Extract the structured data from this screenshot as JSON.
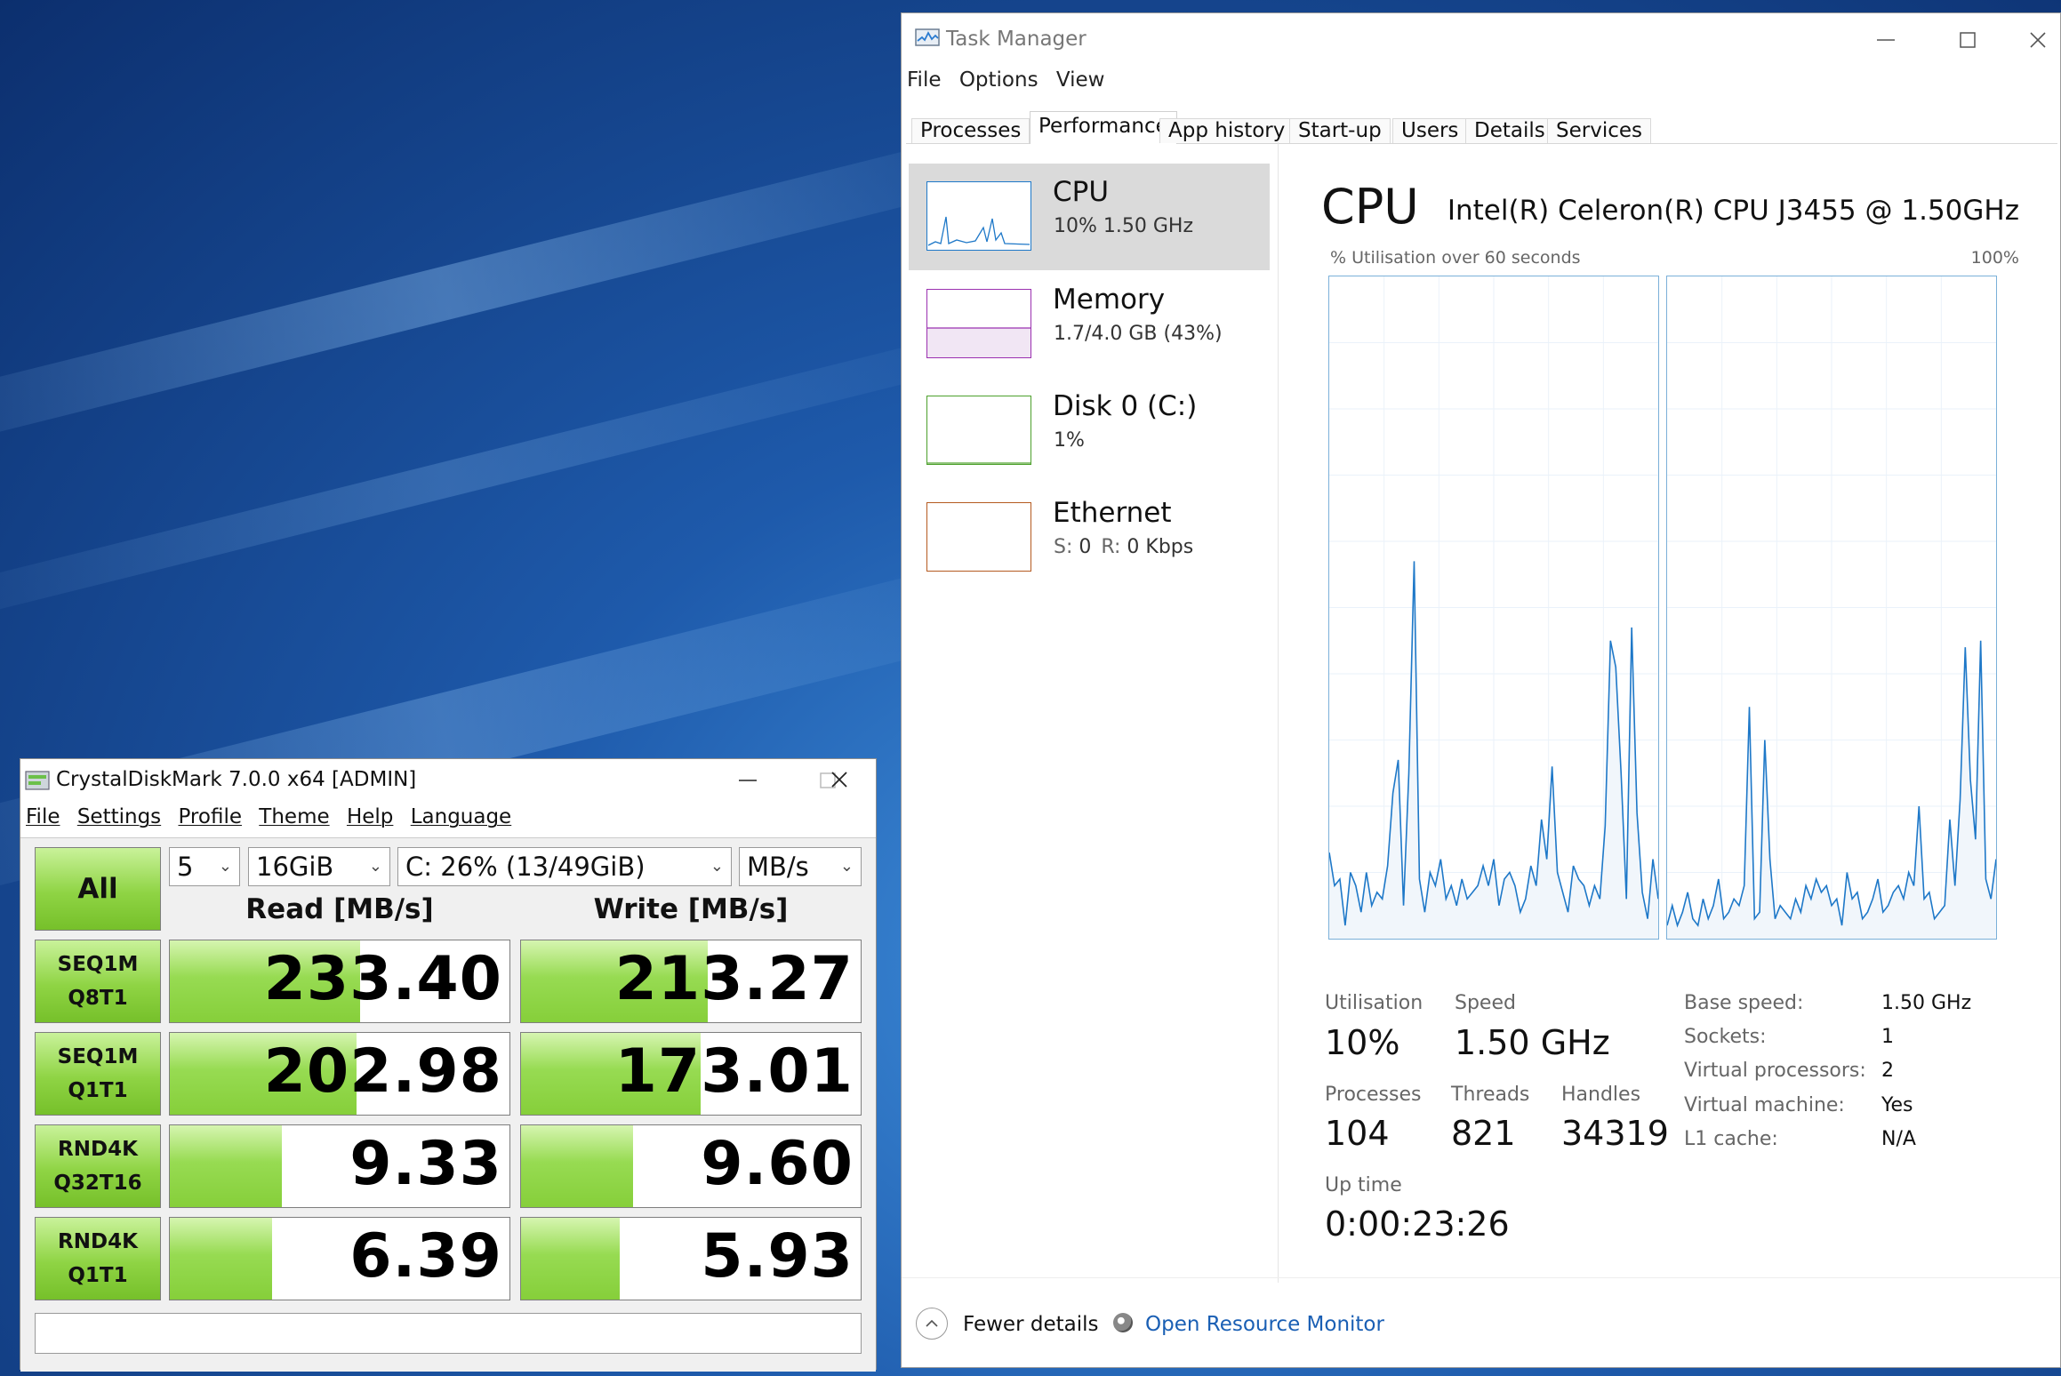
{
  "task_manager": {
    "title": "Task Manager",
    "menu": [
      "File",
      "Options",
      "View"
    ],
    "tabs": [
      "Processes",
      "Performance",
      "App history",
      "Start-up",
      "Users",
      "Details",
      "Services"
    ],
    "active_tab": "Performance",
    "resources": [
      {
        "name": "CPU",
        "value": "10%  1.50 GHz",
        "color": "#1e78c8"
      },
      {
        "name": "Memory",
        "value": "1.7/4.0 GB (43%)",
        "color": "#9b30b0"
      },
      {
        "name": "Disk 0 (C:)",
        "value": "1%",
        "color": "#4da02c"
      },
      {
        "name": "Ethernet",
        "value_s_label": "S:",
        "value_s": "0",
        "value_r_label": "R:",
        "value_r": "0 Kbps",
        "color": "#b55a20"
      }
    ],
    "cpu": {
      "heading": "CPU",
      "model": "Intel(R) Celeron(R) CPU J3455 @ 1.50GHz",
      "util_label": "% Utilisation over 60 seconds",
      "util_max": "100%",
      "stats": {
        "utilisation_label": "Utilisation",
        "utilisation": "10%",
        "speed_label": "Speed",
        "speed": "1.50 GHz",
        "processes_label": "Processes",
        "processes": "104",
        "threads_label": "Threads",
        "threads": "821",
        "handles_label": "Handles",
        "handles": "34319",
        "uptime_label": "Up time",
        "uptime": "0:00:23:26"
      },
      "specs": [
        {
          "label": "Base speed:",
          "value": "1.50 GHz"
        },
        {
          "label": "Sockets:",
          "value": "1"
        },
        {
          "label": "Virtual processors:",
          "value": "2"
        },
        {
          "label": "Virtual machine:",
          "value": "Yes"
        },
        {
          "label": "L1 cache:",
          "value": "N/A"
        }
      ],
      "core_graphs": [
        [
          13,
          8,
          9,
          2,
          10,
          8,
          4,
          10,
          5,
          7,
          6,
          11,
          22,
          27,
          5,
          25,
          57,
          9,
          4,
          10,
          8,
          12,
          6,
          8,
          5,
          9,
          6,
          7,
          8,
          11,
          8,
          12,
          5,
          9,
          10,
          8,
          4,
          6,
          11,
          8,
          18,
          12,
          26,
          10,
          7,
          4,
          11,
          9,
          8,
          5,
          8,
          6,
          17,
          45,
          41,
          25,
          6,
          47,
          19,
          7,
          3,
          12,
          6
        ],
        [
          2,
          5,
          2,
          4,
          7,
          3,
          2,
          6,
          3,
          5,
          9,
          3,
          4,
          6,
          5,
          8,
          35,
          3,
          4,
          30,
          12,
          3,
          5,
          4,
          3,
          6,
          4,
          8,
          6,
          9,
          7,
          8,
          5,
          6,
          2,
          10,
          6,
          7,
          3,
          4,
          6,
          9,
          4,
          5,
          7,
          8,
          6,
          10,
          8,
          20,
          6,
          7,
          3,
          4,
          5,
          18,
          8,
          21,
          44,
          24,
          15,
          45,
          9,
          6,
          12
        ]
      ],
      "accent_color": "#1e78c8"
    },
    "footer": {
      "fewer_details": "Fewer details",
      "open_resource_monitor": "Open Resource Monitor"
    }
  },
  "crystaldiskmark": {
    "title": "CrystalDiskMark 7.0.0 x64 [ADMIN]",
    "menu": [
      "File",
      "Settings",
      "Profile",
      "Theme",
      "Help",
      "Language"
    ],
    "all_button": "All",
    "count": "5",
    "size": "16GiB",
    "drive": "C: 26% (13/49GiB)",
    "unit": "MB/s",
    "read_header": "Read [MB/s]",
    "write_header": "Write [MB/s]",
    "rows": [
      {
        "line1": "SEQ1M",
        "line2": "Q8T1",
        "read": "233.40",
        "write": "213.27",
        "read_fill": 0.56,
        "write_fill": 0.55
      },
      {
        "line1": "SEQ1M",
        "line2": "Q1T1",
        "read": "202.98",
        "write": "173.01",
        "read_fill": 0.55,
        "write_fill": 0.53
      },
      {
        "line1": "RND4K",
        "line2": "Q32T16",
        "read": "9.33",
        "write": "9.60",
        "read_fill": 0.33,
        "write_fill": 0.33
      },
      {
        "line1": "RND4K",
        "line2": "Q1T1",
        "read": "6.39",
        "write": "5.93",
        "read_fill": 0.3,
        "write_fill": 0.29
      }
    ],
    "comment": ""
  }
}
